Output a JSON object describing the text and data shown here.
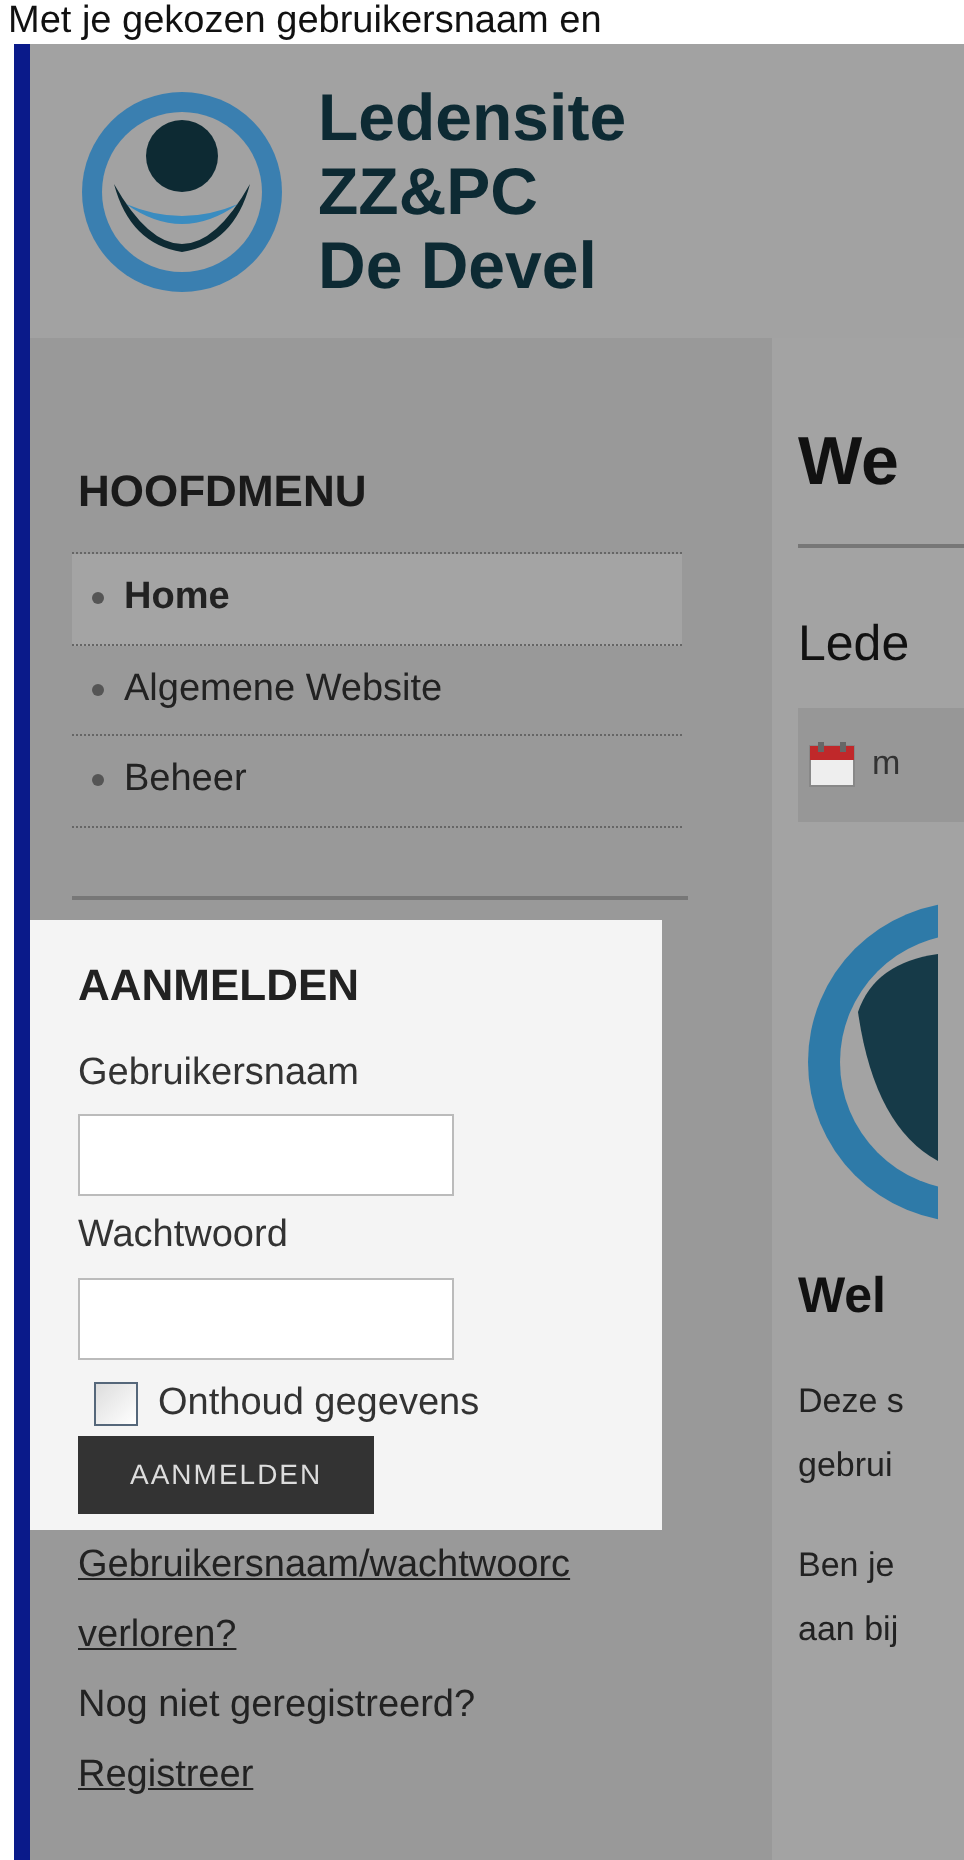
{
  "caption": "Met je gekozen gebruikersnaam en",
  "header": {
    "title_lines": [
      "Ledensite",
      "ZZ&PC",
      "De Devel"
    ]
  },
  "main_menu": {
    "title": "HOOFDMENU",
    "items": [
      {
        "label": "Home",
        "selected": true
      },
      {
        "label": "Algemene Website",
        "selected": false
      },
      {
        "label": "Beheer",
        "selected": false
      }
    ]
  },
  "login": {
    "title": "AANMELDEN",
    "username_label": "Gebruikersnaam",
    "password_label": "Wachtwoord",
    "remember": {
      "label": "Onthoud gegevens",
      "checked": false
    },
    "submit": "AANMELDEN"
  },
  "links": [
    {
      "kind": "link",
      "text": "Gebruikersnaam/wachtwoorc"
    },
    {
      "kind": "link",
      "text": "verloren?"
    },
    {
      "kind": "text",
      "text": "Nog niet geregistreerd?"
    },
    {
      "kind": "link",
      "text": "Registreer"
    }
  ],
  "content": {
    "heading": "We",
    "subheading": "Lede",
    "date_text": "m",
    "section_heading": "Wel",
    "paragraphs": [
      [
        "Deze s",
        "gebrui"
      ],
      [
        "Ben je",
        "aan bij"
      ]
    ]
  }
}
